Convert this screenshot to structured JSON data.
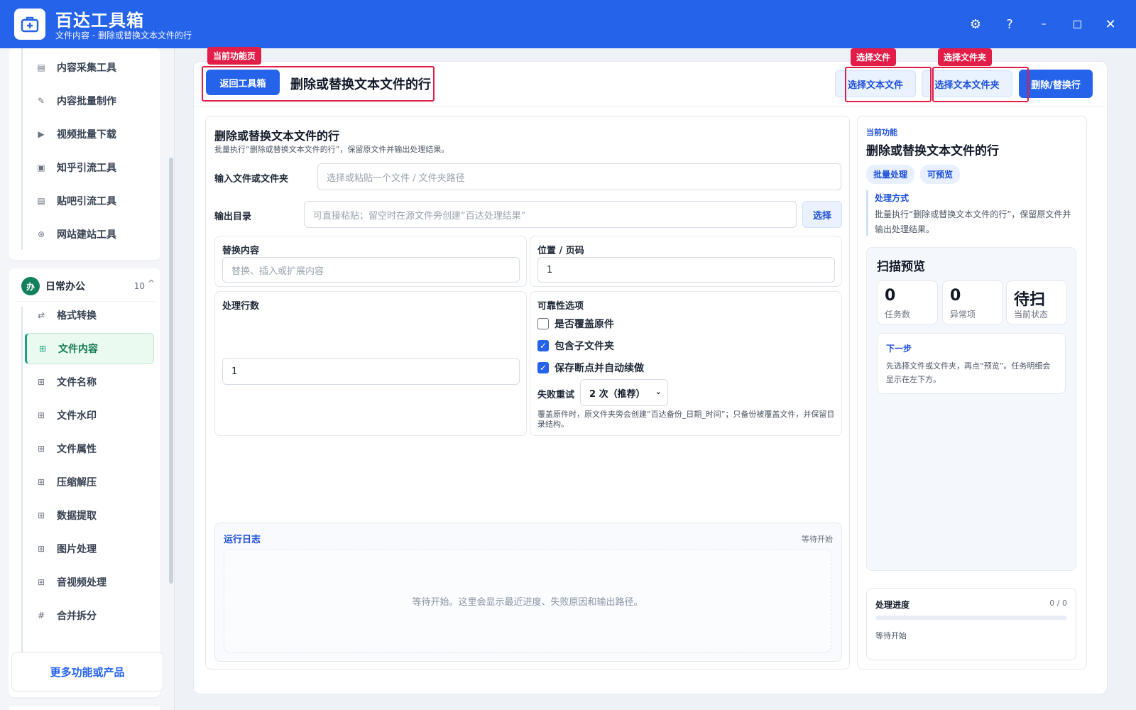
{
  "app": {
    "title": "百达工具箱",
    "subtitle": "文件内容 - 删除或替换文本文件的行"
  },
  "sidebar": {
    "top_items": [
      {
        "label": "内容采集工具",
        "icon": "doc-icon"
      },
      {
        "label": "内容批量制作",
        "icon": "pen-icon"
      },
      {
        "label": "视频批量下载",
        "icon": "video-icon"
      },
      {
        "label": "知乎引流工具",
        "icon": "zhihu-icon"
      },
      {
        "label": "贴吧引流工具",
        "icon": "tieba-icon"
      },
      {
        "label": "网站建站工具",
        "icon": "globe-icon"
      }
    ],
    "group": {
      "badge": "办",
      "name": "日常办公",
      "count": "10",
      "chevron": "^"
    },
    "group_items": [
      {
        "label": "格式转换",
        "icon": "swap-icon"
      },
      {
        "label": "文件内容",
        "icon": "grid-icon",
        "active": true
      },
      {
        "label": "文件名称",
        "icon": "grid-icon"
      },
      {
        "label": "文件水印",
        "icon": "grid-icon"
      },
      {
        "label": "文件属性",
        "icon": "grid-icon"
      },
      {
        "label": "压缩解压",
        "icon": "grid-icon"
      },
      {
        "label": "数据提取",
        "icon": "grid-icon"
      },
      {
        "label": "图片处理",
        "icon": "grid-icon"
      },
      {
        "label": "音视频处理",
        "icon": "grid-icon"
      },
      {
        "label": "合并拆分",
        "icon": "hash-icon"
      }
    ],
    "more": "更多功能或产品"
  },
  "toolbar": {
    "back": "返回工具箱",
    "title": "删除或替换文本文件的行",
    "choose_file": "选择文本文件",
    "choose_folder": "选择文本文件夹",
    "run": "删除/替换行",
    "tag_current": "当前功能页",
    "tag_file": "选择文件",
    "tag_folder": "选择文件夹"
  },
  "form": {
    "title": "删除或替换文本文件的行",
    "desc": "批量执行“删除或替换文本文件的行”，保留原文件并输出处理结果。",
    "input_label": "输入文件或文件夹",
    "input_placeholder": "选择或粘贴一个文件 / 文件夹路径",
    "output_label": "输出目录",
    "output_placeholder": "可直接粘贴；留空时在源文件旁创建“百达处理结果”",
    "output_button": "选择",
    "replace_label": "替换内容",
    "replace_placeholder": "替换、插入或扩展内容",
    "position_label": "位置 / 页码",
    "position_value": "1",
    "lines_label": "处理行数",
    "lines_value": "1",
    "options_label": "可靠性选项",
    "options": [
      {
        "label": "是否覆盖原件",
        "checked": false
      },
      {
        "label": "包含子文件夹",
        "checked": true
      },
      {
        "label": "保存断点并自动续做",
        "checked": true
      }
    ],
    "retry_label": "失败重试",
    "retry_value": "2 次（推荐）",
    "note": "覆盖原件时，原文件夹旁会创建“百达备份_日期_时间”；只备份被覆盖文件，并保留目录结构。"
  },
  "log": {
    "title": "运行日志",
    "status": "等待开始",
    "empty": "等待开始。这里会显示最近进度、失败原因和输出路径。"
  },
  "right": {
    "kicker": "当前功能",
    "title": "删除或替换文本文件的行",
    "pills": [
      "批量处理",
      "可预览"
    ],
    "method_title": "处理方式",
    "method_desc": "批量执行“删除或替换文本文件的行”，保留原文件并输出处理结果。",
    "scan_title": "扫描预览",
    "stats": [
      {
        "num": "0",
        "cap": "任务数"
      },
      {
        "num": "0",
        "cap": "异常项"
      },
      {
        "num": "待扫",
        "cap": "当前状态"
      }
    ],
    "next_title": "下一步",
    "next_desc": "先选择文件或文件夹，再点“预览”。任务明细会显示在左下方。",
    "progress_title": "处理进度",
    "progress_count": "0 / 0",
    "progress_value": 0,
    "progress_status": "等待开始"
  },
  "colors": {
    "brand": "#2563eb",
    "accent_green": "#16a37f",
    "annotation_red": "#e11d48"
  }
}
